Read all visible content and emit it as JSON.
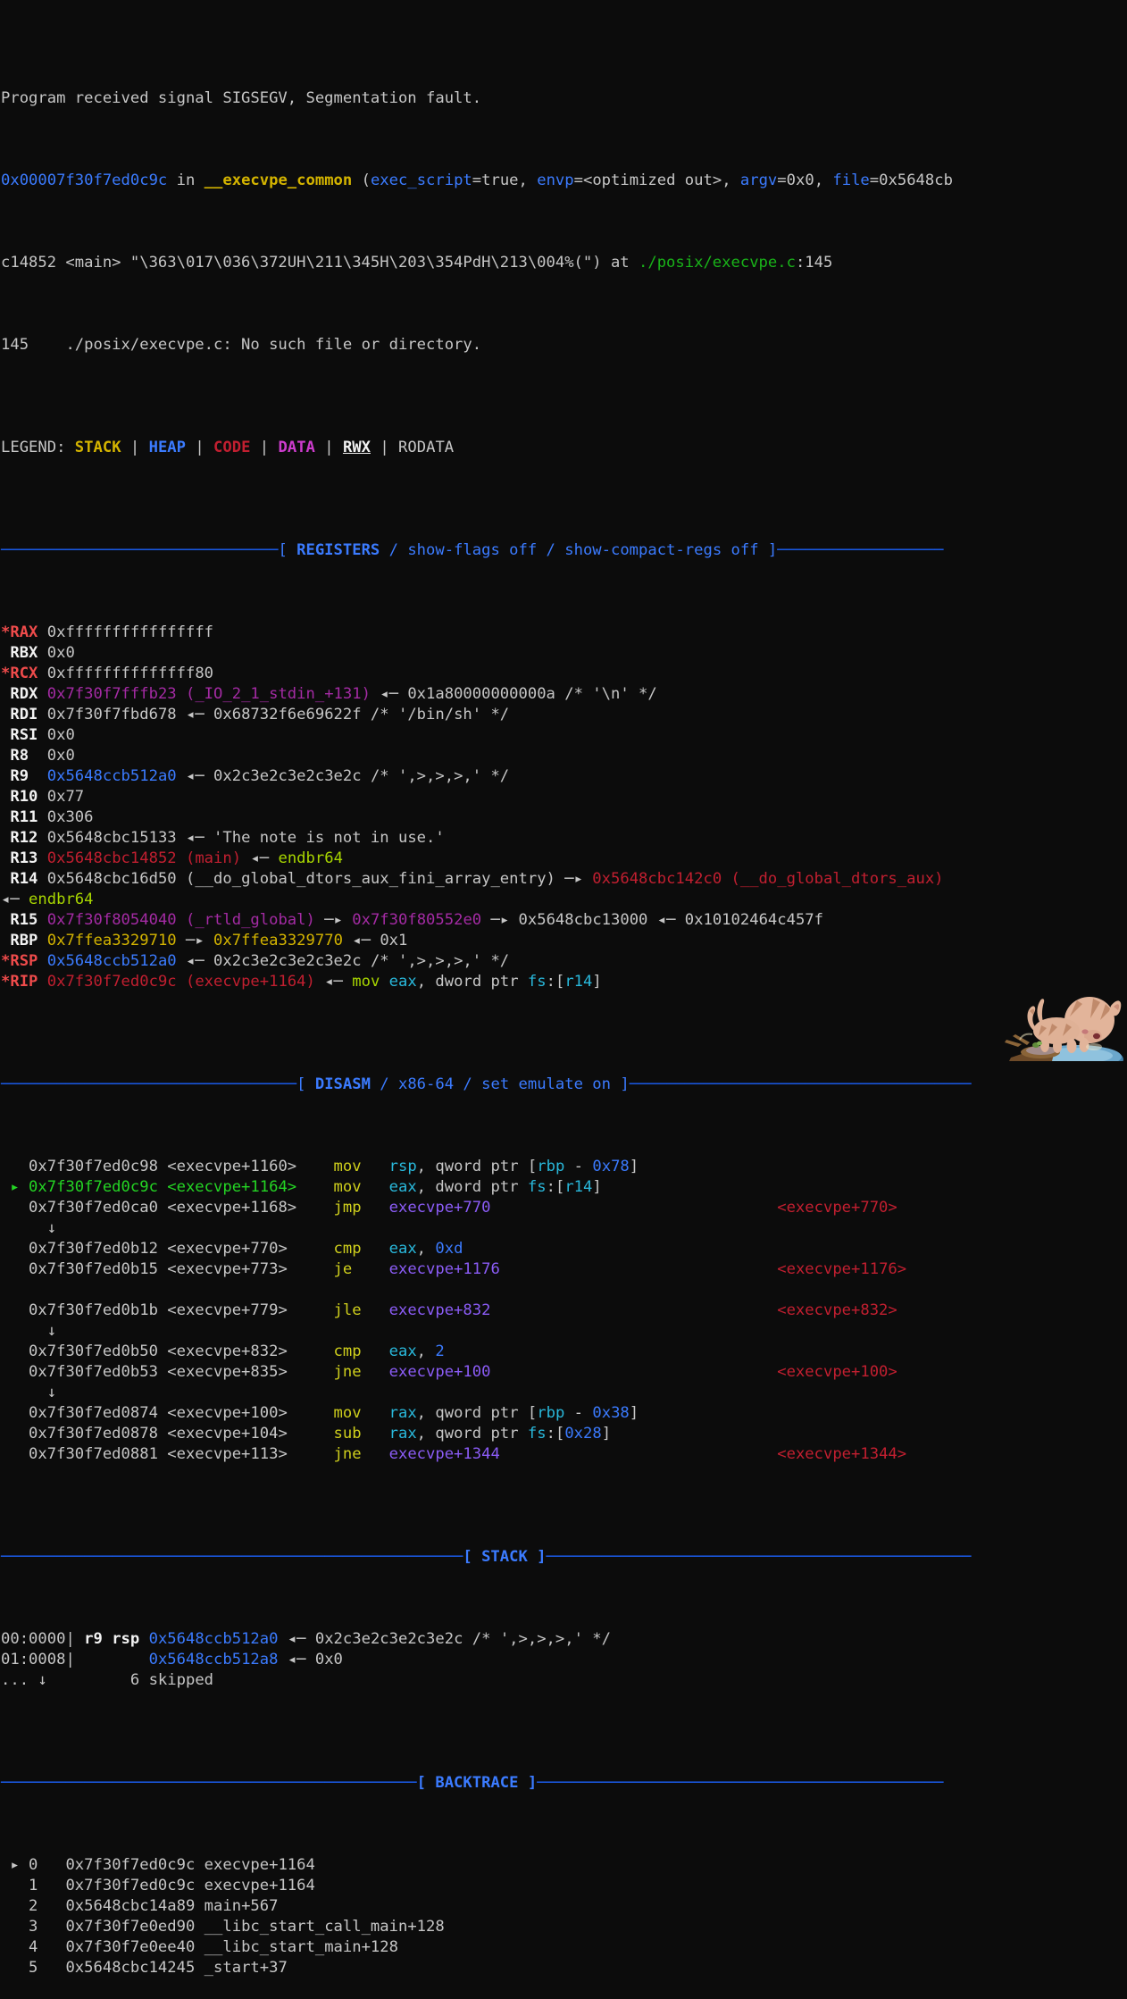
{
  "terminal": {
    "background": "#0c0c0c",
    "default_fg": "#d0d0d0"
  },
  "signal": {
    "line1": "Program received signal SIGSEGV, Segmentation fault.",
    "addr": "0x00007f30f7ed0c9c",
    "in_kw": " in ",
    "func": "__execvpe_common",
    "paren_open": " (",
    "arg1_name": "exec_script",
    "arg1_val": "=true, ",
    "arg2_name": "envp",
    "arg2_val": "=<optimized out>, ",
    "arg3_name": "argv",
    "arg3_val": "=0x0, ",
    "arg4_name": "file",
    "arg4_val": "=0x5648cb",
    "wrap_line": "c14852 <main> \"\\363\\017\\036\\372UH\\211\\345H\\203\\354PdH\\213\\004%(\")",
    "wrap_at": " at ",
    "srcfile": "./posix/execvpe.c",
    "srcline": ":145",
    "nosrc_num": "145",
    "nosrc_text": "    ./posix/execvpe.c: No such file or directory."
  },
  "legend": {
    "label": "LEGEND: ",
    "items": [
      {
        "text": "STACK",
        "color": "yellow"
      },
      {
        "text": "HEAP",
        "color": "blue"
      },
      {
        "text": "CODE",
        "color": "red"
      },
      {
        "text": "DATA",
        "color": "magenta"
      },
      {
        "text": "RWX",
        "color": "white-underline"
      },
      {
        "text": "RODATA",
        "color": "white"
      }
    ],
    "separator": " | "
  },
  "banners": {
    "registers": "[ REGISTERS / show-flags off / show-compact-regs off ]",
    "registers_parts": [
      "[ ",
      "REGISTERS",
      " / ",
      "show-flags off",
      " / ",
      "show-compact-regs off",
      " ]"
    ],
    "disasm": "[ DISASM / x86-64 / set emulate on ]",
    "disasm_parts": [
      "[ ",
      "DISASM",
      " / ",
      "x86-64",
      " / ",
      "set emulate on",
      " ]"
    ],
    "stack": "[ STACK ]",
    "backtrace": "[ BACKTRACE ]"
  },
  "registers": [
    {
      "star": "*",
      "name": "RAX",
      "value": "0xffffffffffffffff"
    },
    {
      "star": " ",
      "name": "RBX",
      "value": "0x0"
    },
    {
      "star": "*",
      "name": "RCX",
      "value": "0xffffffffffffff80"
    },
    {
      "star": " ",
      "name": "RDX",
      "value": "0x7f30f7fffb23 (_IO_2_1_stdin_+131) <- 0x1a80000000000a /* '\\n' */"
    },
    {
      "star": " ",
      "name": "RDI",
      "value": "0x7f30f7fbd678 <- 0x68732f6e69622f /* '/bin/sh' */"
    },
    {
      "star": " ",
      "name": "RSI",
      "value": "0x0"
    },
    {
      "star": " ",
      "name": "R8",
      "value": "0x0"
    },
    {
      "star": " ",
      "name": "R9",
      "value": "0x5648ccb512a0 <- 0x2c3e2c3e2c3e2c /* ',>,>,>,' */"
    },
    {
      "star": " ",
      "name": "R10",
      "value": "0x77"
    },
    {
      "star": " ",
      "name": "R11",
      "value": "0x306"
    },
    {
      "star": " ",
      "name": "R12",
      "value": "0x5648cbc15133 <- 'The note is not in use.'"
    },
    {
      "star": " ",
      "name": "R13",
      "value": "0x5648cbc14852 (main) <- endbr64"
    },
    {
      "star": " ",
      "name": "R14",
      "value": "0x5648cbc16d50 (__do_global_dtors_aux_fini_array_entry) -> 0x5648cbc142c0 (__do_global_dtors_aux) <- endbr64"
    },
    {
      "star": " ",
      "name": "R15",
      "value": "0x7f30f8054040 (_rtld_global) -> 0x7f30f80552e0 -> 0x5648cbc13000 <- 0x10102464c457f"
    },
    {
      "star": " ",
      "name": "RBP",
      "value": "0x7ffea3329710 -> 0x7ffea3329770 <- 0x1"
    },
    {
      "star": "*",
      "name": "RSP",
      "value": "0x5648ccb512a0 <- 0x2c3e2c3e2c3e2c /* ',>,>,>,' */"
    },
    {
      "star": "*",
      "name": "RIP",
      "value": "0x7f30f7ed0c9c (execvpe+1164) <- mov eax, dword ptr fs:[r14]"
    }
  ],
  "disasm": [
    {
      "marker": " ",
      "current": false,
      "addr": "0x7f30f7ed0c98",
      "sym": "<execvpe+1160>",
      "mnem": "mov",
      "ops": "rsp, qword ptr [rbp - 0x78]",
      "target": ""
    },
    {
      "marker": "▸",
      "current": true,
      "addr": "0x7f30f7ed0c9c",
      "sym": "<execvpe+1164>",
      "mnem": "mov",
      "ops": "eax, dword ptr fs:[r14]",
      "target": ""
    },
    {
      "marker": " ",
      "current": false,
      "addr": "0x7f30f7ed0ca0",
      "sym": "<execvpe+1168>",
      "mnem": "jmp",
      "ops": "execvpe+770",
      "target": "<execvpe+770>"
    },
    {
      "down_arrow": true
    },
    {
      "marker": " ",
      "current": false,
      "addr": "0x7f30f7ed0b12",
      "sym": "<execvpe+770>",
      "mnem": "cmp",
      "ops": "eax, 0xd",
      "target": ""
    },
    {
      "marker": " ",
      "current": false,
      "addr": "0x7f30f7ed0b15",
      "sym": "<execvpe+773>",
      "mnem": "je",
      "ops": "execvpe+1176",
      "target": "<execvpe+1176>"
    },
    {
      "blank": true
    },
    {
      "marker": " ",
      "current": false,
      "addr": "0x7f30f7ed0b1b",
      "sym": "<execvpe+779>",
      "mnem": "jle",
      "ops": "execvpe+832",
      "target": "<execvpe+832>"
    },
    {
      "down_arrow": true
    },
    {
      "marker": " ",
      "current": false,
      "addr": "0x7f30f7ed0b50",
      "sym": "<execvpe+832>",
      "mnem": "cmp",
      "ops": "eax, 2",
      "target": ""
    },
    {
      "marker": " ",
      "current": false,
      "addr": "0x7f30f7ed0b53",
      "sym": "<execvpe+835>",
      "mnem": "jne",
      "ops": "execvpe+100",
      "target": "<execvpe+100>"
    },
    {
      "down_arrow": true
    },
    {
      "marker": " ",
      "current": false,
      "addr": "0x7f30f7ed0874",
      "sym": "<execvpe+100>",
      "mnem": "mov",
      "ops": "rax, qword ptr [rbp - 0x38]",
      "target": ""
    },
    {
      "marker": " ",
      "current": false,
      "addr": "0x7f30f7ed0878",
      "sym": "<execvpe+104>",
      "mnem": "sub",
      "ops": "rax, qword ptr fs:[0x28]",
      "target": ""
    },
    {
      "marker": " ",
      "current": false,
      "addr": "0x7f30f7ed0881",
      "sym": "<execvpe+113>",
      "mnem": "jne",
      "ops": "execvpe+1344",
      "target": "<execvpe+1344>"
    }
  ],
  "stack": [
    {
      "offset": "00:0000",
      "regs": "r9 rsp",
      "addr": "0x5648ccb512a0",
      "rest": "<- 0x2c3e2c3e2c3e2c /* ',>,>,>,' */"
    },
    {
      "offset": "01:0008",
      "regs": "",
      "addr": "0x5648ccb512a8",
      "rest": "<- 0x0"
    },
    {
      "offset": "... ↓",
      "regs": "",
      "addr": "",
      "rest": "6 skipped",
      "skipped": true
    }
  ],
  "backtrace": [
    {
      "marker": "▸",
      "idx": "0",
      "addr": "0x7f30f7ed0c9c",
      "sym": "execvpe+1164"
    },
    {
      "marker": " ",
      "idx": "1",
      "addr": "0x7f30f7ed0c9c",
      "sym": "execvpe+1164"
    },
    {
      "marker": " ",
      "idx": "2",
      "addr": "0x5648cbc14a89",
      "sym": "main+567"
    },
    {
      "marker": " ",
      "idx": "3",
      "addr": "0x7f30f7e0ed90",
      "sym": "__libc_start_call_main+128"
    },
    {
      "marker": " ",
      "idx": "4",
      "addr": "0x7f30f7e0ee40",
      "sym": "__libc_start_main+128"
    },
    {
      "marker": " ",
      "idx": "5",
      "addr": "0x5648cbc14245",
      "sym": "_start+37"
    }
  ],
  "decoration": {
    "image": "cat-figurine-drinking-from-blue-bowl"
  }
}
